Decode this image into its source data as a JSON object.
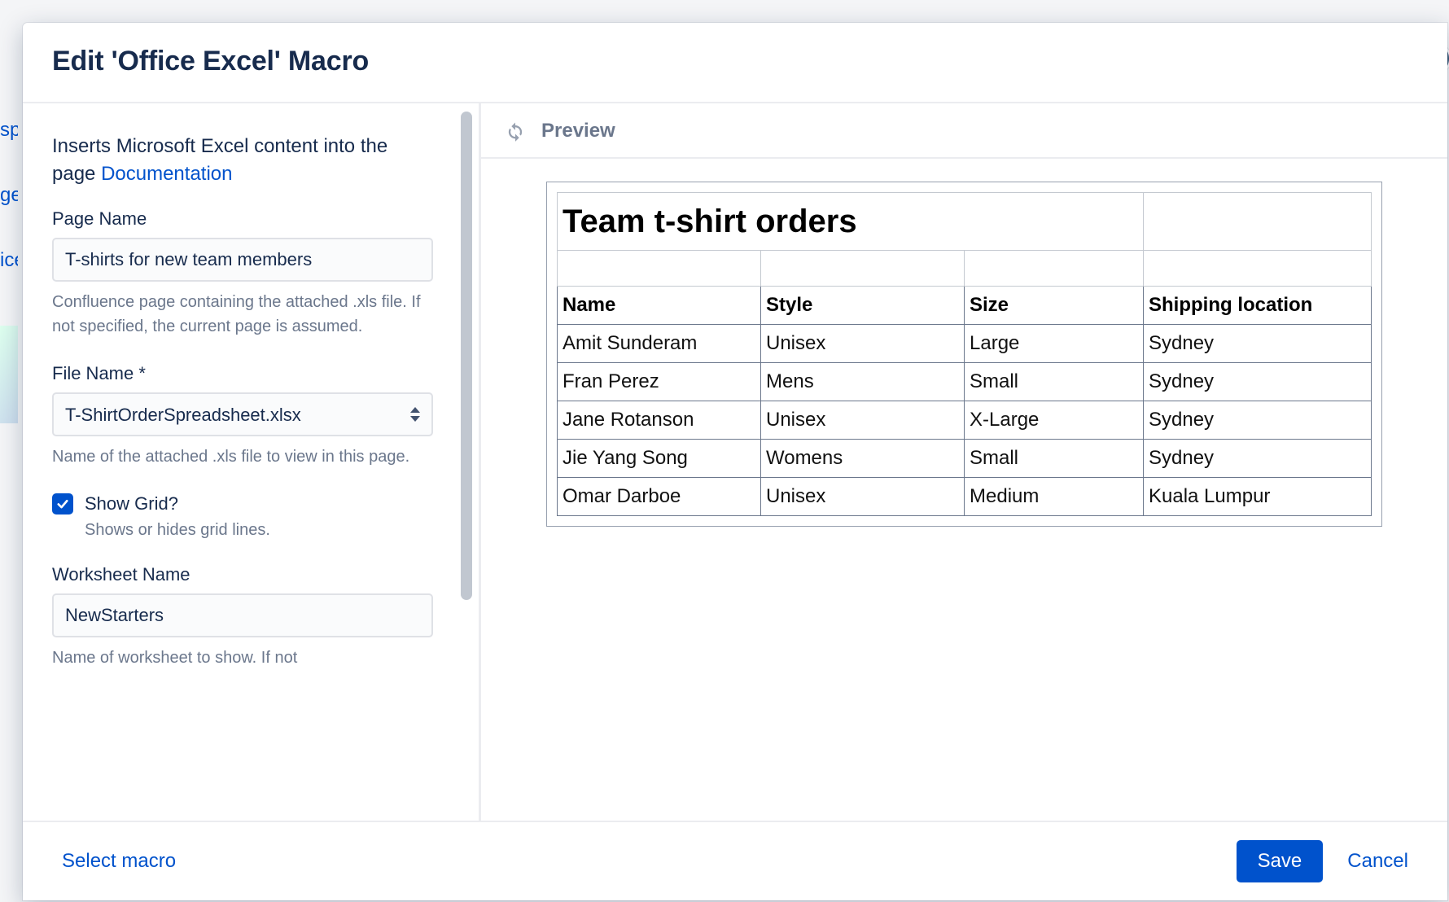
{
  "modal": {
    "title": "Edit 'Office Excel' Macro"
  },
  "description": {
    "prefix": "Inserts Microsoft Excel content into the page ",
    "link_text": "Documentation"
  },
  "fields": {
    "page_name": {
      "label": "Page Name",
      "value": "T-shirts for new team members",
      "help": "Confluence page containing the attached .xls file. If not specified, the current page is assumed."
    },
    "file_name": {
      "label": "File Name *",
      "value": "T-ShirtOrderSpreadsheet.xlsx",
      "help": "Name of the attached .xls file to view in this page."
    },
    "show_grid": {
      "label": "Show Grid?",
      "checked": true,
      "help": "Shows or hides grid lines."
    },
    "worksheet_name": {
      "label": "Worksheet Name",
      "value": "NewStarters",
      "help": "Name of worksheet to show. If not"
    }
  },
  "preview": {
    "header": "Preview",
    "table_title": "Team t-shirt orders",
    "columns": [
      "Name",
      "Style",
      "Size",
      "Shipping location"
    ],
    "rows": [
      [
        "Amit Sunderam",
        "Unisex",
        "Large",
        "Sydney"
      ],
      [
        "Fran Perez",
        "Mens",
        "Small",
        "Sydney"
      ],
      [
        "Jane Rotanson",
        "Unisex",
        "X-Large",
        "Sydney"
      ],
      [
        "Jie Yang Song",
        "Womens",
        "Small",
        "Sydney"
      ],
      [
        "Omar Darboe",
        "Unisex",
        "Medium",
        "Kuala Lumpur"
      ]
    ]
  },
  "footer": {
    "select_macro": "Select macro",
    "save": "Save",
    "cancel": "Cancel"
  }
}
